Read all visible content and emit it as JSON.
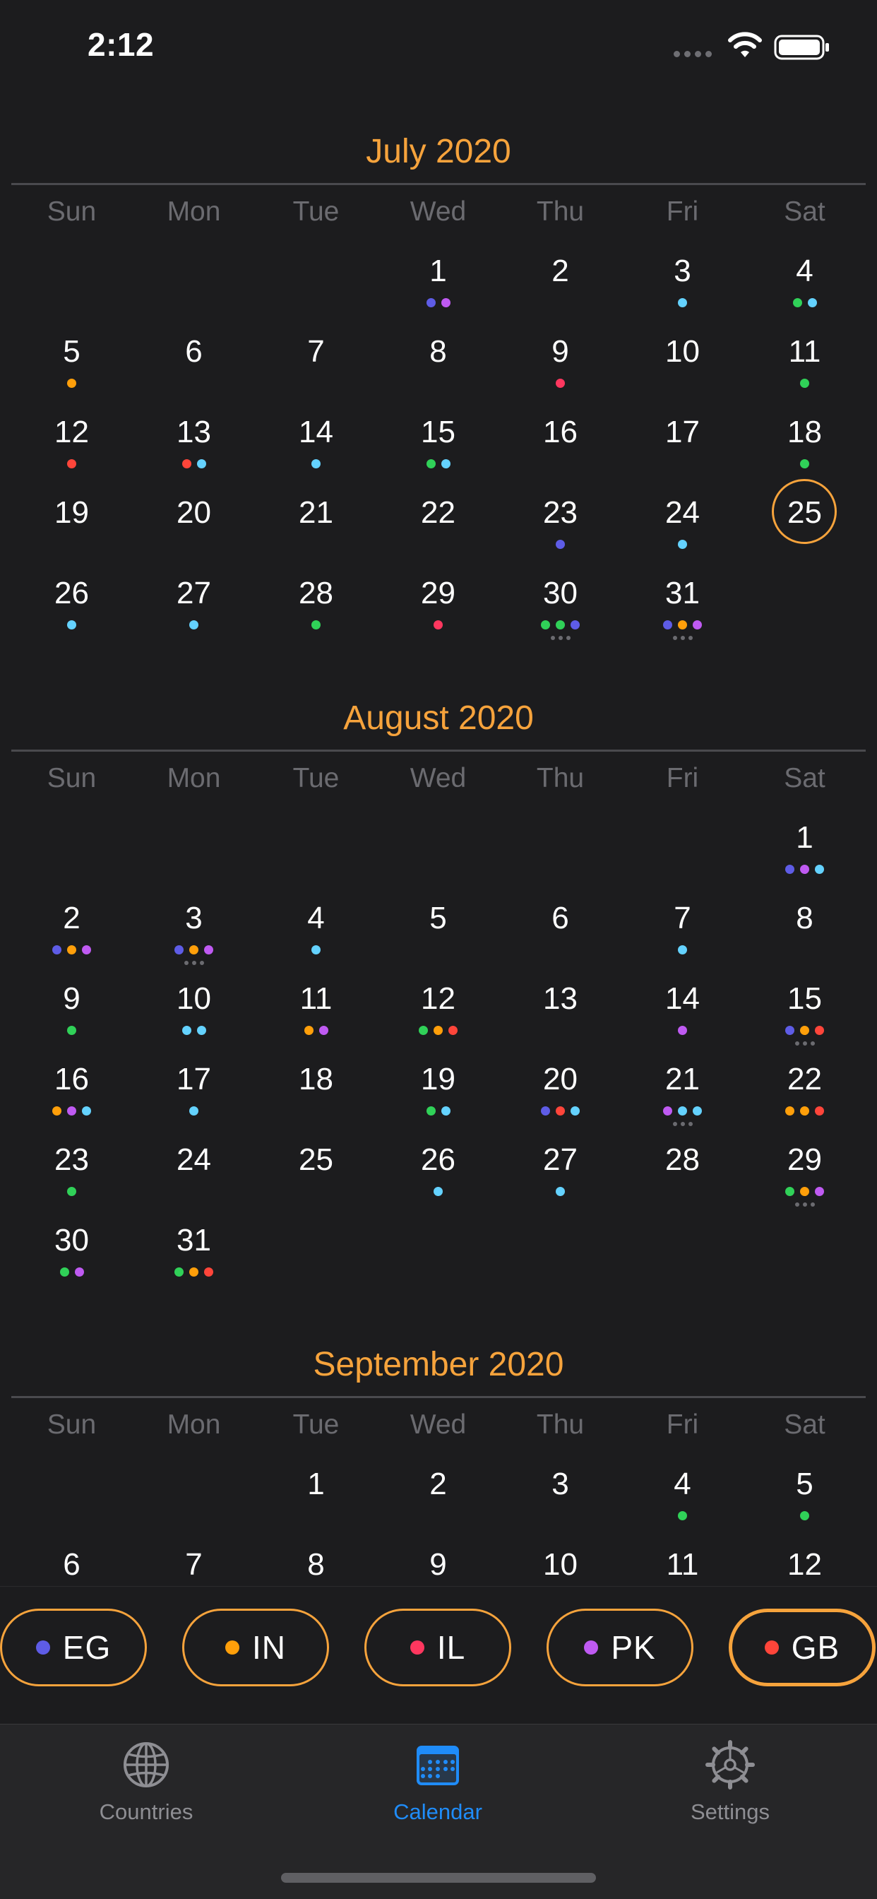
{
  "status_bar": {
    "time": "2:12"
  },
  "calendar": {
    "weekdays": [
      "Sun",
      "Mon",
      "Tue",
      "Wed",
      "Thu",
      "Fri",
      "Sat"
    ],
    "today": {
      "month": "July 2020",
      "day": 25
    },
    "months": [
      {
        "title": "July 2020",
        "first_weekday": 3,
        "days_in_month": 31,
        "days": {
          "1": {
            "dots": [
              "EG",
              "PK"
            ]
          },
          "3": {
            "dots": [
              "GB2"
            ]
          },
          "4": {
            "dots": [
              "GR",
              "GB2"
            ]
          },
          "5": {
            "dots": [
              "IN"
            ]
          },
          "9": {
            "dots": [
              "IL"
            ]
          },
          "11": {
            "dots": [
              "GR"
            ]
          },
          "12": {
            "dots": [
              "GB"
            ]
          },
          "13": {
            "dots": [
              "GB",
              "GB2"
            ]
          },
          "14": {
            "dots": [
              "GB2"
            ]
          },
          "15": {
            "dots": [
              "GR",
              "GB2"
            ]
          },
          "18": {
            "dots": [
              "GR"
            ]
          },
          "23": {
            "dots": [
              "EG"
            ]
          },
          "24": {
            "dots": [
              "GB2"
            ]
          },
          "26": {
            "dots": [
              "GB2"
            ]
          },
          "27": {
            "dots": [
              "GB2"
            ]
          },
          "28": {
            "dots": [
              "GR"
            ]
          },
          "29": {
            "dots": [
              "IL"
            ]
          },
          "30": {
            "dots": [
              "GR",
              "GR",
              "EG"
            ],
            "more": true
          },
          "31": {
            "dots": [
              "EG",
              "IN",
              "PK"
            ],
            "more": true
          }
        }
      },
      {
        "title": "August 2020",
        "first_weekday": 6,
        "days_in_month": 31,
        "days": {
          "1": {
            "dots": [
              "EG",
              "PK",
              "GB2"
            ]
          },
          "2": {
            "dots": [
              "EG",
              "IN",
              "PK"
            ]
          },
          "3": {
            "dots": [
              "EG",
              "IN",
              "PK"
            ],
            "more": true
          },
          "4": {
            "dots": [
              "GB2"
            ]
          },
          "7": {
            "dots": [
              "GB2"
            ]
          },
          "9": {
            "dots": [
              "GR"
            ]
          },
          "10": {
            "dots": [
              "GB2",
              "GB2"
            ]
          },
          "11": {
            "dots": [
              "IN",
              "PK"
            ]
          },
          "12": {
            "dots": [
              "GR",
              "IN",
              "GB"
            ]
          },
          "14": {
            "dots": [
              "PK"
            ]
          },
          "15": {
            "dots": [
              "EG",
              "IN",
              "GB"
            ],
            "more": true
          },
          "16": {
            "dots": [
              "IN",
              "PK",
              "GB2"
            ]
          },
          "17": {
            "dots": [
              "GB2"
            ]
          },
          "19": {
            "dots": [
              "GR",
              "GB2"
            ]
          },
          "20": {
            "dots": [
              "EG",
              "GB",
              "GB2"
            ]
          },
          "21": {
            "dots": [
              "PK",
              "GB2",
              "GB2"
            ],
            "more": true
          },
          "22": {
            "dots": [
              "IN",
              "IN",
              "GB"
            ]
          },
          "23": {
            "dots": [
              "GR"
            ]
          },
          "26": {
            "dots": [
              "GB2"
            ]
          },
          "27": {
            "dots": [
              "GB2"
            ]
          },
          "29": {
            "dots": [
              "GR",
              "IN",
              "PK"
            ],
            "more": true
          },
          "30": {
            "dots": [
              "GR",
              "PK"
            ]
          },
          "31": {
            "dots": [
              "GR",
              "IN",
              "GB"
            ]
          }
        }
      },
      {
        "title": "September 2020",
        "first_weekday": 2,
        "days_in_month": 30,
        "days": {
          "4": {
            "dots": [
              "GR"
            ]
          },
          "5": {
            "dots": [
              "GR"
            ]
          }
        }
      }
    ]
  },
  "dot_colors": {
    "EG": "#5e5ce6",
    "IN": "#ff9f0a",
    "IL": "#ff375f",
    "PK": "#bf5af2",
    "GB": "#ff453a",
    "GR": "#30d158",
    "GB2": "#64d2ff"
  },
  "filters": [
    {
      "label": "EG",
      "color": "#5e5ce6",
      "selected": false
    },
    {
      "label": "IN",
      "color": "#ff9f0a",
      "selected": false
    },
    {
      "label": "IL",
      "color": "#ff375f",
      "selected": false
    },
    {
      "label": "PK",
      "color": "#bf5af2",
      "selected": false
    },
    {
      "label": "GB",
      "color": "#ff453a",
      "selected": true
    }
  ],
  "tab_bar": {
    "tabs": [
      {
        "label": "Countries",
        "icon": "globe-icon",
        "active": false
      },
      {
        "label": "Calendar",
        "icon": "calendar-icon",
        "active": true
      },
      {
        "label": "Settings",
        "icon": "gear-icon",
        "active": false
      }
    ]
  },
  "colors": {
    "accent": "#f6a33c",
    "tab_active": "#1f8cf9",
    "tab_inactive": "#8e8e93",
    "background": "#1c1c1e"
  }
}
